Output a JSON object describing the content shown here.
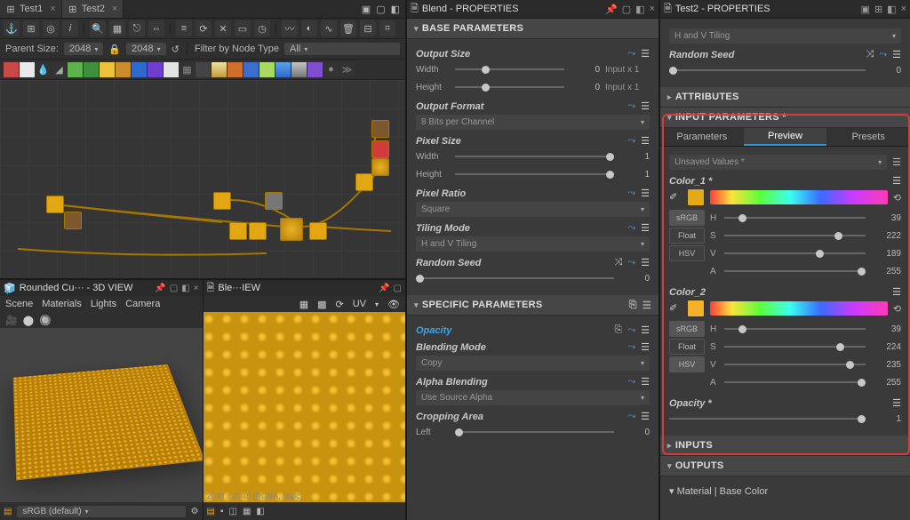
{
  "tabs": {
    "t1": "Test1",
    "t2": "Test2"
  },
  "sizebar": {
    "label": "Parent Size:",
    "a": "2048",
    "b": "2048",
    "filter_label": "Filter by Node Type",
    "filter_value": "All"
  },
  "preview3d": {
    "title": "Rounded Cu··· - 3D VIEW",
    "menu": [
      "Scene",
      "Materials",
      "Lights",
      "Camera"
    ],
    "footer_label": "sRGB (default)"
  },
  "preview2d": {
    "title": "Ble···IEW",
    "uv": "UV",
    "foot_info": "2048 x 2048 (RGBA, 8bpc)"
  },
  "panel1": {
    "title": "Blend - PROPERTIES",
    "base": "BASE PARAMETERS",
    "output_size": "Output Size",
    "width": "Width",
    "height": "Height",
    "w_val": "0",
    "h_val": "0",
    "w_extra": "Input x 1",
    "h_extra": "Input x 1",
    "output_format": "Output Format",
    "fmt": "8 Bits per Channel",
    "pixel_size": "Pixel Size",
    "ps_w": "1",
    "ps_h": "1",
    "pixel_ratio": "Pixel Ratio",
    "ratio": "Square",
    "tiling": "Tiling Mode",
    "tiling_val": "H and V Tiling",
    "random": "Random Seed",
    "rs_val": "0",
    "specific": "SPECIFIC PARAMETERS",
    "opacity": "Opacity",
    "blend": "Blending Mode",
    "blend_val": "Copy",
    "alpha": "Alpha Blending",
    "alpha_val": "Use Source Alpha",
    "crop": "Cropping Area",
    "left": "Left",
    "left_val": "0"
  },
  "panel2": {
    "title": "Test2 - PROPERTIES",
    "tiling_val": "H and V Tiling",
    "random": "Random Seed",
    "rs_val": "0",
    "attributes": "ATTRIBUTES",
    "input": "INPUT PARAMETERS *",
    "subtabs": {
      "a": "Parameters",
      "b": "Preview",
      "c": "Presets"
    },
    "unsaved": "Unsaved Values *",
    "c1": "Color_1 *",
    "c2": "Color_2",
    "chan": {
      "h": "H",
      "s": "S",
      "v": "V",
      "a": "A"
    },
    "c1v": {
      "h": "39",
      "s": "222",
      "v": "189",
      "a": "255"
    },
    "c2v": {
      "h": "39",
      "s": "224",
      "v": "235",
      "a": "255"
    },
    "btns": {
      "srgb": "sRGB",
      "float": "Float",
      "hsv": "HSV"
    },
    "opacity": "Opacity *",
    "opacity_val": "1",
    "inputs": "INPUTS",
    "outputs": "OUTPUTS",
    "material": "Material | Base Color"
  }
}
